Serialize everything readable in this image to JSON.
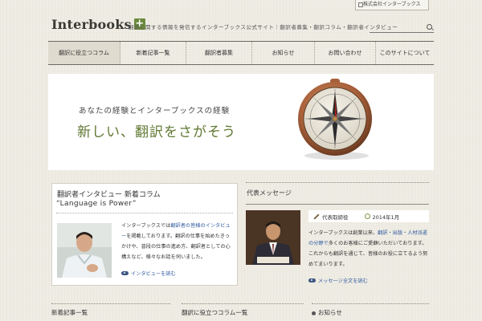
{
  "header": {
    "logo_text": "Interbooks",
    "logo_mark": "+",
    "tagline": "翻訳に関する情報を発信するインターブックス公式サイト｜翻訳者募集・翻訳コラム・翻訳者インタビュー",
    "company_link": "株式会社インターブックス",
    "search_placeholder": ""
  },
  "nav": {
    "items": [
      {
        "label": "翻訳に役立つコラム",
        "width": 90
      },
      {
        "label": "新着記事一覧",
        "width": 82
      },
      {
        "label": "翻訳者募集",
        "width": 82
      },
      {
        "label": "お知らせ",
        "width": 78
      },
      {
        "label": "お問い合わせ",
        "width": 76
      },
      {
        "label": "このサイトについて",
        "width": 72
      }
    ]
  },
  "hero": {
    "line1": "あなたの経験とインターブックスの経験",
    "line2": "新しい、翻訳をさがそう"
  },
  "column": {
    "title": "翻訳者インタビュー 新着コラム",
    "subtitle": "“Language is Power”",
    "body_pre": "インターブックスでは",
    "body_link": "翻訳者の皆様のインタビュー",
    "body_post": "を掲載しております。翻訳の仕事を始めたきっかけや、普段の仕事の進め方、翻訳者としての心構えなど、様々なお話を伺いました。",
    "more": "インタビューを読む"
  },
  "message": {
    "title": "代表メッセージ",
    "author": "代表取締役",
    "date": "2014年1月",
    "body_pre": "インターブックスは創業以来、",
    "body_link": "翻訳・出版・人材派遣の分野で",
    "body_post": "多くのお客様にご愛顧いただいております。これからも翻訳を通じて、皆様のお役に立てるよう努めてまいります。",
    "more": "メッセージ全文を読む"
  },
  "bottom": {
    "titles": [
      "新着記事一覧",
      "翻訳に役立つコラム一覧",
      "お知らせ"
    ]
  }
}
